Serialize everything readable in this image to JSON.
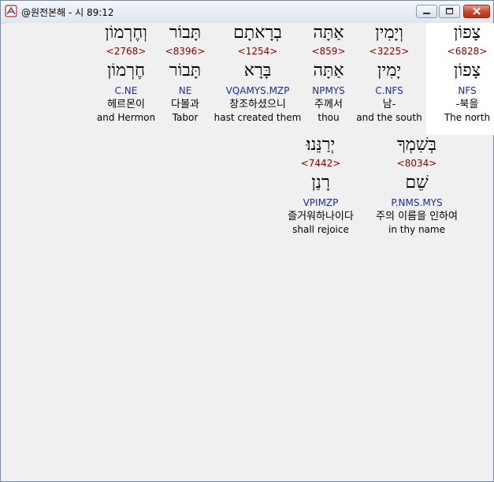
{
  "window": {
    "title": "@원전본해 - 시 89:12"
  },
  "rows": [
    {
      "words": [
        {
          "hebrew": "צָפוֹן",
          "strong": "<6828>",
          "lemma": "צָפוֹן",
          "morph": "NFS",
          "korean": "-북을",
          "english": "The north",
          "highlighted": true
        },
        {
          "hebrew": "וְיָמִין",
          "strong": "<3225>",
          "lemma": "יָמִין",
          "morph": "C.NFS",
          "korean": "남-",
          "english": "and the south",
          "highlighted": false
        },
        {
          "hebrew": "אַתָּה",
          "strong": "<859>",
          "lemma": "אַתָּה",
          "morph": "NPMYS",
          "korean": "주께서",
          "english": "thou",
          "highlighted": false
        },
        {
          "hebrew": "בְרָאתָם",
          "strong": "<1254>",
          "lemma": "בָּרָא",
          "morph": "VQAMYS.MZP",
          "korean": "창조하셨으니",
          "english": "hast created them",
          "highlighted": false
        },
        {
          "hebrew": "תָּבוֹר",
          "strong": "<8396>",
          "lemma": "תָּבוֹר",
          "morph": "NE",
          "korean": "다볼과",
          "english": "Tabor",
          "highlighted": false
        },
        {
          "hebrew": "וְחֶרְמוֹן",
          "strong": "<2768>",
          "lemma": "חֶרְמוֹן",
          "morph": "C.NE",
          "korean": "헤르몬이",
          "english": "and Hermon",
          "highlighted": false
        }
      ]
    },
    {
      "words": [
        {
          "hebrew": "בְּשִׁמְךָ",
          "strong": "<8034>",
          "lemma": "שֵׁם",
          "morph": "P.NMS.MYS",
          "korean": "주의 이름을 인하여",
          "english": "in thy name",
          "highlighted": false
        },
        {
          "hebrew": "יְרַנֵּנוּ׃",
          "strong": "<7442>",
          "lemma": "רָנַן",
          "morph": "VPIMZP",
          "korean": "즐거워하나이다",
          "english": "shall rejoice",
          "highlighted": false
        }
      ]
    }
  ]
}
